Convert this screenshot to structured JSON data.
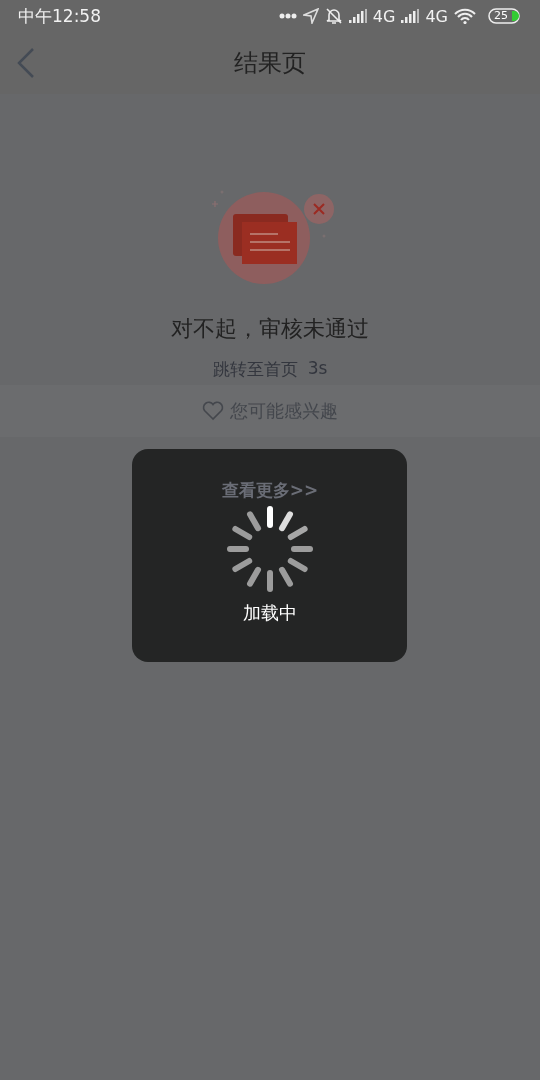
{
  "status_bar": {
    "time": "中午12:58",
    "network_1": "4G",
    "network_2": "4G",
    "battery": "25"
  },
  "header": {
    "title": "结果页"
  },
  "result": {
    "title": "对不起，审核未通过",
    "redirect": "跳转至首页",
    "countdown": "3s"
  },
  "interest": {
    "label": "您可能感兴趣"
  },
  "more_link": "查看更多>>",
  "toast": {
    "text": "加载中"
  }
}
